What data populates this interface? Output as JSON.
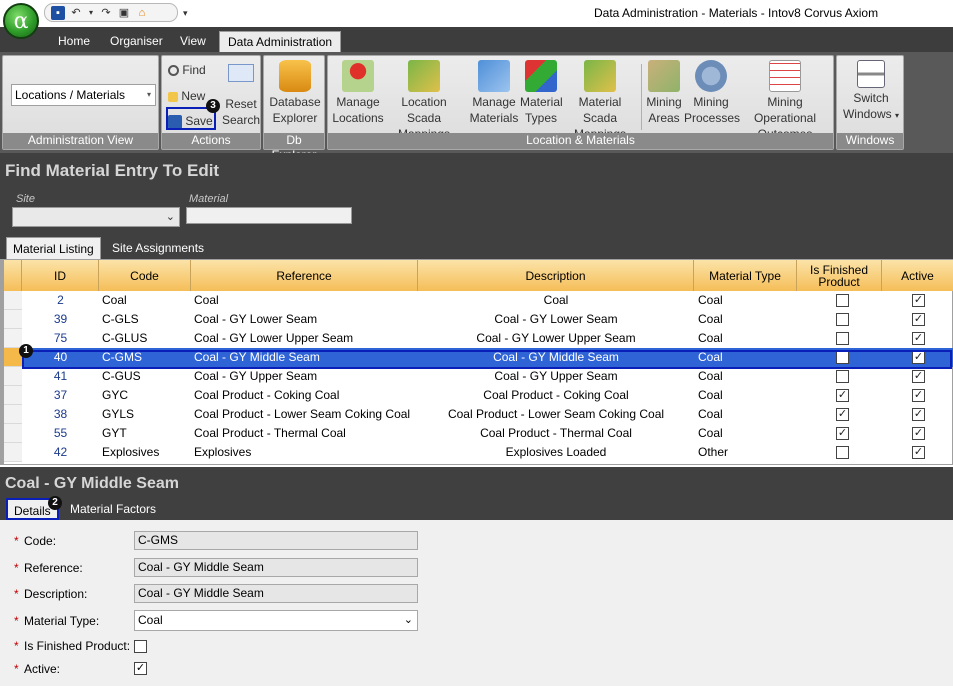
{
  "window": {
    "title": "Data Administration - Materials - Intov8 Corvus Axiom"
  },
  "app_orb": {
    "glyph": "α"
  },
  "ribbon_tabs": [
    "Home",
    "Organiser",
    "View",
    "Data Administration"
  ],
  "ribbon": {
    "admin_view": {
      "combo_value": "Locations / Materials",
      "group_label": "Administration View"
    },
    "actions": {
      "find": "Find",
      "new": "New",
      "save": "Save",
      "reset_line1": "Reset",
      "reset_line2": "Search",
      "group_label": "Actions"
    },
    "db_explorer": {
      "line1": "Database",
      "line2": "Explorer",
      "group_label": "Db Explorer"
    },
    "location_materials": {
      "group_label": "Location & Materials",
      "buttons": [
        {
          "line1": "Manage",
          "line2": "Locations"
        },
        {
          "line1": "Location Scada",
          "line2": "Mappings"
        },
        {
          "line1": "Manage",
          "line2": "Materials"
        },
        {
          "line1": "Material",
          "line2": "Types"
        },
        {
          "line1": "Material Scada",
          "line2": "Mappings"
        },
        {
          "line1": "Mining",
          "line2": "Areas"
        },
        {
          "line1": "Mining",
          "line2": "Processes"
        },
        {
          "line1": "Mining Operational",
          "line2": "Outcomes"
        }
      ]
    },
    "windows": {
      "line1": "Switch",
      "line2": "Windows",
      "group_label": "Windows"
    }
  },
  "find_panel": {
    "title": "Find Material Entry To Edit",
    "site_label": "Site",
    "material_label": "Material",
    "site_value": "",
    "material_value": ""
  },
  "listing_tabs": [
    "Material Listing",
    "Site Assignments"
  ],
  "grid": {
    "columns": [
      "ID",
      "Code",
      "Reference",
      "Description",
      "Material Type",
      "Is Finished Product",
      "Active"
    ],
    "rows": [
      {
        "id": "2",
        "code": "Coal",
        "reference": "Coal",
        "description": "Coal",
        "type": "Coal",
        "finished": false,
        "active": true
      },
      {
        "id": "39",
        "code": "C-GLS",
        "reference": "Coal - GY Lower Seam",
        "description": "Coal - GY Lower Seam",
        "type": "Coal",
        "finished": false,
        "active": true
      },
      {
        "id": "75",
        "code": "C-GLUS",
        "reference": "Coal - GY Lower Upper Seam",
        "description": "Coal - GY Lower Upper Seam",
        "type": "Coal",
        "finished": false,
        "active": true
      },
      {
        "id": "40",
        "code": "C-GMS",
        "reference": "Coal - GY Middle Seam",
        "description": "Coal - GY Middle Seam",
        "type": "Coal",
        "finished": false,
        "active": true
      },
      {
        "id": "41",
        "code": "C-GUS",
        "reference": "Coal - GY Upper Seam",
        "description": "Coal - GY Upper Seam",
        "type": "Coal",
        "finished": false,
        "active": true
      },
      {
        "id": "37",
        "code": "GYC",
        "reference": "Coal Product - Coking Coal",
        "description": "Coal Product - Coking Coal",
        "type": "Coal",
        "finished": true,
        "active": true
      },
      {
        "id": "38",
        "code": "GYLS",
        "reference": "Coal Product - Lower Seam Coking Coal",
        "description": "Coal Product - Lower Seam Coking Coal",
        "type": "Coal",
        "finished": true,
        "active": true
      },
      {
        "id": "55",
        "code": "GYT",
        "reference": "Coal Product - Thermal Coal",
        "description": "Coal Product - Thermal Coal",
        "type": "Coal",
        "finished": true,
        "active": true
      },
      {
        "id": "42",
        "code": "Explosives",
        "reference": "Explosives",
        "description": "Explosives Loaded",
        "type": "Other",
        "finished": false,
        "active": true
      }
    ],
    "selected_index": 3
  },
  "details": {
    "title": "Coal - GY Middle Seam",
    "tabs": [
      "Details",
      "Material Factors"
    ],
    "required_mark": "*",
    "fields": {
      "code": {
        "label": "Code:",
        "value": "C-GMS"
      },
      "reference": {
        "label": "Reference:",
        "value": "Coal - GY Middle Seam"
      },
      "description": {
        "label": "Description:",
        "value": "Coal - GY Middle Seam"
      },
      "material_type": {
        "label": "Material Type:",
        "value": "Coal"
      },
      "is_finished": {
        "label": "Is Finished Product:",
        "checked": false
      },
      "active": {
        "label": "Active:",
        "checked": true
      }
    }
  },
  "annotations": [
    "1",
    "2",
    "3"
  ],
  "colors": {
    "selection": "#2f64d6",
    "header_orange": "#f5be58",
    "outline": "#0a1fb8",
    "dark_panel": "#404040"
  }
}
